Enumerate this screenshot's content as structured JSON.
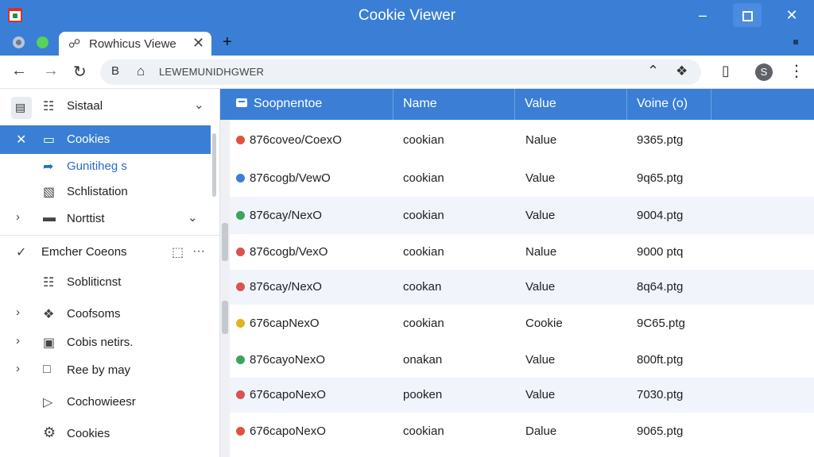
{
  "window": {
    "title": "Cookie Viewer",
    "minimize_glyph": "–",
    "close_glyph": "✕"
  },
  "tab": {
    "title": "Rowhicus Viewe",
    "close_glyph": "✕",
    "new_tab_glyph": "+"
  },
  "toolbar": {
    "back_glyph": "←",
    "forward_glyph": "→",
    "reload_glyph": "↻",
    "site_glyph": "B",
    "home_glyph": "⌂",
    "url": "LEWEMUNIDHGWER",
    "collapse_glyph": "⌃",
    "extensions_glyph": "❖",
    "clipboard_glyph": "▯",
    "profile_glyph": "S",
    "menu_glyph": "⋮"
  },
  "sidebar": {
    "header": {
      "label": "Sistaal",
      "chevron": "⌄"
    },
    "items": [
      {
        "label": "Cookies",
        "icon": "close-icon",
        "glyph": "✕",
        "icon2": "card-icon",
        "glyph2": "▭"
      },
      {
        "label": "Gunitiheg s",
        "icon": "share-arrow-icon",
        "glyph": "➦"
      },
      {
        "label": "Schlistation",
        "icon": "document-icon",
        "glyph": "▧"
      },
      {
        "label": "Norttist",
        "icon": "folder-icon",
        "glyph": "▬",
        "expand": "›",
        "chevron": "⌄"
      },
      {
        "label": "Emcher Coeons",
        "icon": "check-icon",
        "glyph": "✓",
        "icon2": "comment-icon",
        "glyph2": "⬚",
        "more": "···"
      },
      {
        "label": "Sobliticnst",
        "icon": "document-icon",
        "glyph": "☷"
      },
      {
        "label": "Coofsoms",
        "icon": "puzzle-icon",
        "glyph": "❖",
        "expand": "›"
      },
      {
        "label": "Cobis netirs.",
        "icon": "calendar-icon",
        "glyph": "▣",
        "expand": "›"
      },
      {
        "label": "Ree by may",
        "icon": "folder-outline-icon",
        "glyph": "□",
        "expand": "›"
      },
      {
        "label": "Cochowieesr",
        "icon": "play-icon",
        "glyph": "▷"
      },
      {
        "label": "Cookies",
        "icon": "gear-icon",
        "glyph": "⚙"
      }
    ]
  },
  "table": {
    "columns": [
      "Soopnentoe",
      "Name",
      "Value",
      "Voine (o)"
    ],
    "rows": [
      {
        "domain": "876coveo/CoexO",
        "name": "cookian",
        "value": "Nalue",
        "size": "9365.ptg",
        "fav_color": "#e0533b"
      },
      {
        "domain": "876cogb/VewO",
        "name": "cookian",
        "value": "Value",
        "size": "9q65.ptg",
        "fav_color": "#3a7fd5"
      },
      {
        "domain": "876cay/NexO",
        "name": "cookian",
        "value": "Value",
        "size": "9004.ptg",
        "fav_color": "#3aa55b"
      },
      {
        "domain": "876cogb/VexO",
        "name": "cookian",
        "value": "Nalue",
        "size": "9000 ptq",
        "fav_color": "#d9534f"
      },
      {
        "domain": "876cay/NexO",
        "name": "cookan",
        "value": "Value",
        "size": "8q64.ptg",
        "fav_color": "#d9534f"
      },
      {
        "domain": "676capNexO",
        "name": "cookian",
        "value": "Cookie",
        "size": "9C65.ptg",
        "fav_color": "#e3b21c"
      },
      {
        "domain": "876cayoNexO",
        "name": "onakan",
        "value": "Value",
        "size": "800ft.ptg",
        "fav_color": "#3aa55b"
      },
      {
        "domain": "676capoNexO",
        "name": "pooken",
        "value": "Value",
        "size": "7030.ptg",
        "fav_color": "#d9534f"
      },
      {
        "domain": "676capoNexO",
        "name": "cookian",
        "value": "Dalue",
        "size": "9065.ptg",
        "fav_color": "#e0533b"
      }
    ]
  }
}
